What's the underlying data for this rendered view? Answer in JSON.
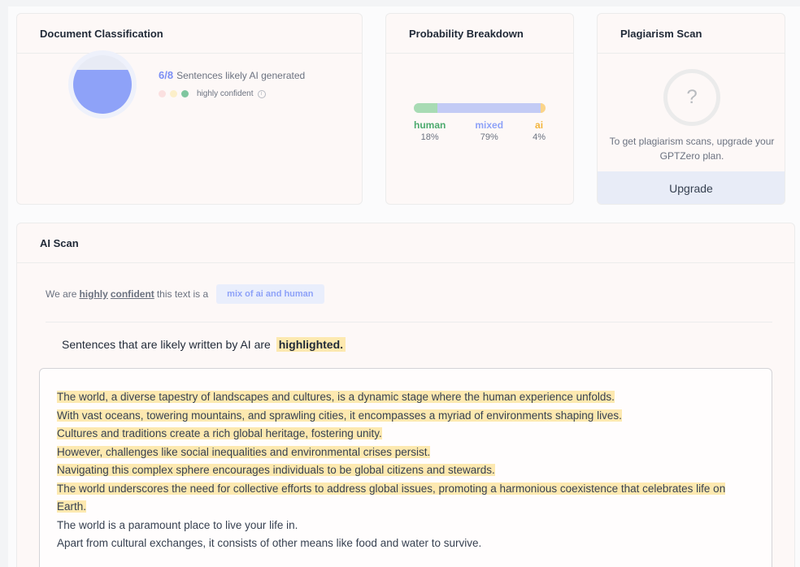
{
  "classification": {
    "title": "Document Classification",
    "fraction": "6/8",
    "caption": "Sentences likely AI generated",
    "ai_fraction": 0.75,
    "confidence_label": "highly confident",
    "info_icon": "info-icon",
    "dots": [
      "#fbe0e0",
      "#fcefc9",
      "#7fc69f"
    ]
  },
  "breakdown": {
    "title": "Probability Breakdown",
    "segments": [
      {
        "label": "human",
        "percent": "18%",
        "value": 18,
        "color": "#a8dbb4",
        "text_color": "#4caa6e"
      },
      {
        "label": "mixed",
        "percent": "79%",
        "value": 79,
        "color": "#c3cbf5",
        "text_color": "#8ea2f8"
      },
      {
        "label": "ai",
        "percent": "4%",
        "value": 4,
        "color": "#fbd489",
        "text_color": "#f3b53d"
      }
    ]
  },
  "plagiarism": {
    "title": "Plagiarism Scan",
    "icon_glyph": "?",
    "message": "To get plagiarism scans, upgrade your GPTZero plan.",
    "upgrade_label": "Upgrade"
  },
  "ai_scan": {
    "title": "AI Scan",
    "verdict_prefix": "We are",
    "verdict_word1": "highly",
    "verdict_word2": "confident",
    "verdict_suffix": "this text is a",
    "verdict_pill": "mix of ai and human",
    "legend_prefix": "Sentences that are likely written by AI are",
    "legend_highlight": "highlighted.",
    "sentences": [
      {
        "text": "The world, a diverse tapestry of landscapes and cultures, is a dynamic stage where the human experience unfolds.",
        "ai": true
      },
      {
        "text": "With vast oceans, towering mountains, and sprawling cities, it encompasses a myriad of environments shaping lives.",
        "ai": true
      },
      {
        "text": "Cultures and traditions create a rich global heritage, fostering unity.",
        "ai": true
      },
      {
        "text": "However, challenges like social inequalities and environmental crises persist.",
        "ai": true
      },
      {
        "text": "Navigating this complex sphere encourages individuals to be global citizens and stewards.",
        "ai": true
      },
      {
        "text": "The world underscores the need for collective efforts to address global issues, promoting a harmonious coexistence that celebrates life on Earth.",
        "ai": true
      },
      {
        "text": "The world is a paramount place to live your life in.",
        "ai": false
      },
      {
        "text": "Apart from cultural exchanges, it consists of other means like food and water to survive.",
        "ai": false
      }
    ]
  }
}
